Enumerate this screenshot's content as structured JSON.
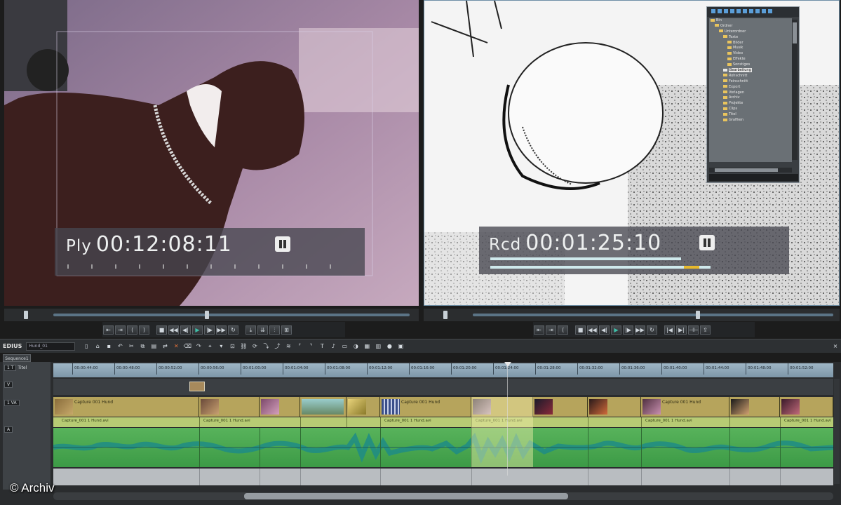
{
  "player": {
    "mode": "Ply",
    "timecode": "00:12:08:11"
  },
  "recorder": {
    "mode": "Rcd",
    "timecode": "00:01:25:10"
  },
  "bin_tree": {
    "items": [
      "Bin",
      "Ordner",
      "Unterordner",
      "Texte",
      "Bilder",
      "Musik",
      "Video",
      "Effekte",
      "Sonstiges",
      "Bearbeitung",
      "Rohschnitt",
      "Feinschnitt",
      "Export",
      "Vorlagen",
      "Archiv",
      "Projekte",
      "Clips",
      "Titel",
      "Grafiken"
    ],
    "selected": "Bearbeitung"
  },
  "toolbar": {
    "brand": "EDIUS",
    "project_name": "Hund_01"
  },
  "timeline": {
    "tab_label": "Sequence1",
    "tracks": [
      {
        "tag": "1 T",
        "label": "Titel"
      },
      {
        "tag": "V",
        "label": ""
      },
      {
        "tag": "1 VA",
        "label": ""
      },
      {
        "tag": "A",
        "label": ""
      }
    ],
    "ruler_labels": [
      "00:00:44:00",
      "00:00:48:00",
      "00:00:52:00",
      "00:00:56:00",
      "00:01:00:00",
      "00:01:04:00",
      "00:01:08:00",
      "00:01:12:00",
      "00:01:16:00",
      "00:01:20:00",
      "00:01:24:00",
      "00:01:28:00",
      "00:01:32:00",
      "00:01:36:00",
      "00:01:40:00",
      "00:01:44:00",
      "00:01:48:00",
      "00:01:52:00"
    ],
    "clip_caption": "Capture 001 Hund",
    "audio_caption": "Capture_001 1 Hund.avi"
  },
  "watermark": "© Archiv",
  "colors": {
    "accent": "#3fbfa8",
    "video_track": "#b6a45c",
    "audio_track": "#4aa64f",
    "ruler": "#8ea6b8"
  }
}
